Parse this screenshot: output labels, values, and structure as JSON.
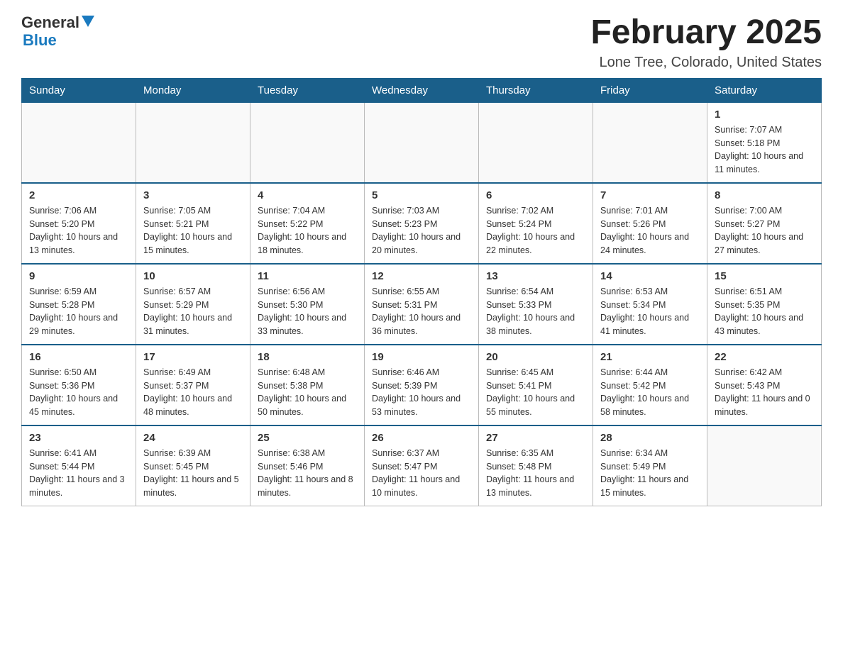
{
  "logo": {
    "general": "General",
    "blue": "Blue"
  },
  "header": {
    "title": "February 2025",
    "location": "Lone Tree, Colorado, United States"
  },
  "weekdays": [
    "Sunday",
    "Monday",
    "Tuesday",
    "Wednesday",
    "Thursday",
    "Friday",
    "Saturday"
  ],
  "weeks": [
    [
      {
        "day": "",
        "info": ""
      },
      {
        "day": "",
        "info": ""
      },
      {
        "day": "",
        "info": ""
      },
      {
        "day": "",
        "info": ""
      },
      {
        "day": "",
        "info": ""
      },
      {
        "day": "",
        "info": ""
      },
      {
        "day": "1",
        "info": "Sunrise: 7:07 AM\nSunset: 5:18 PM\nDaylight: 10 hours and 11 minutes."
      }
    ],
    [
      {
        "day": "2",
        "info": "Sunrise: 7:06 AM\nSunset: 5:20 PM\nDaylight: 10 hours and 13 minutes."
      },
      {
        "day": "3",
        "info": "Sunrise: 7:05 AM\nSunset: 5:21 PM\nDaylight: 10 hours and 15 minutes."
      },
      {
        "day": "4",
        "info": "Sunrise: 7:04 AM\nSunset: 5:22 PM\nDaylight: 10 hours and 18 minutes."
      },
      {
        "day": "5",
        "info": "Sunrise: 7:03 AM\nSunset: 5:23 PM\nDaylight: 10 hours and 20 minutes."
      },
      {
        "day": "6",
        "info": "Sunrise: 7:02 AM\nSunset: 5:24 PM\nDaylight: 10 hours and 22 minutes."
      },
      {
        "day": "7",
        "info": "Sunrise: 7:01 AM\nSunset: 5:26 PM\nDaylight: 10 hours and 24 minutes."
      },
      {
        "day": "8",
        "info": "Sunrise: 7:00 AM\nSunset: 5:27 PM\nDaylight: 10 hours and 27 minutes."
      }
    ],
    [
      {
        "day": "9",
        "info": "Sunrise: 6:59 AM\nSunset: 5:28 PM\nDaylight: 10 hours and 29 minutes."
      },
      {
        "day": "10",
        "info": "Sunrise: 6:57 AM\nSunset: 5:29 PM\nDaylight: 10 hours and 31 minutes."
      },
      {
        "day": "11",
        "info": "Sunrise: 6:56 AM\nSunset: 5:30 PM\nDaylight: 10 hours and 33 minutes."
      },
      {
        "day": "12",
        "info": "Sunrise: 6:55 AM\nSunset: 5:31 PM\nDaylight: 10 hours and 36 minutes."
      },
      {
        "day": "13",
        "info": "Sunrise: 6:54 AM\nSunset: 5:33 PM\nDaylight: 10 hours and 38 minutes."
      },
      {
        "day": "14",
        "info": "Sunrise: 6:53 AM\nSunset: 5:34 PM\nDaylight: 10 hours and 41 minutes."
      },
      {
        "day": "15",
        "info": "Sunrise: 6:51 AM\nSunset: 5:35 PM\nDaylight: 10 hours and 43 minutes."
      }
    ],
    [
      {
        "day": "16",
        "info": "Sunrise: 6:50 AM\nSunset: 5:36 PM\nDaylight: 10 hours and 45 minutes."
      },
      {
        "day": "17",
        "info": "Sunrise: 6:49 AM\nSunset: 5:37 PM\nDaylight: 10 hours and 48 minutes."
      },
      {
        "day": "18",
        "info": "Sunrise: 6:48 AM\nSunset: 5:38 PM\nDaylight: 10 hours and 50 minutes."
      },
      {
        "day": "19",
        "info": "Sunrise: 6:46 AM\nSunset: 5:39 PM\nDaylight: 10 hours and 53 minutes."
      },
      {
        "day": "20",
        "info": "Sunrise: 6:45 AM\nSunset: 5:41 PM\nDaylight: 10 hours and 55 minutes."
      },
      {
        "day": "21",
        "info": "Sunrise: 6:44 AM\nSunset: 5:42 PM\nDaylight: 10 hours and 58 minutes."
      },
      {
        "day": "22",
        "info": "Sunrise: 6:42 AM\nSunset: 5:43 PM\nDaylight: 11 hours and 0 minutes."
      }
    ],
    [
      {
        "day": "23",
        "info": "Sunrise: 6:41 AM\nSunset: 5:44 PM\nDaylight: 11 hours and 3 minutes."
      },
      {
        "day": "24",
        "info": "Sunrise: 6:39 AM\nSunset: 5:45 PM\nDaylight: 11 hours and 5 minutes."
      },
      {
        "day": "25",
        "info": "Sunrise: 6:38 AM\nSunset: 5:46 PM\nDaylight: 11 hours and 8 minutes."
      },
      {
        "day": "26",
        "info": "Sunrise: 6:37 AM\nSunset: 5:47 PM\nDaylight: 11 hours and 10 minutes."
      },
      {
        "day": "27",
        "info": "Sunrise: 6:35 AM\nSunset: 5:48 PM\nDaylight: 11 hours and 13 minutes."
      },
      {
        "day": "28",
        "info": "Sunrise: 6:34 AM\nSunset: 5:49 PM\nDaylight: 11 hours and 15 minutes."
      },
      {
        "day": "",
        "info": ""
      }
    ]
  ]
}
